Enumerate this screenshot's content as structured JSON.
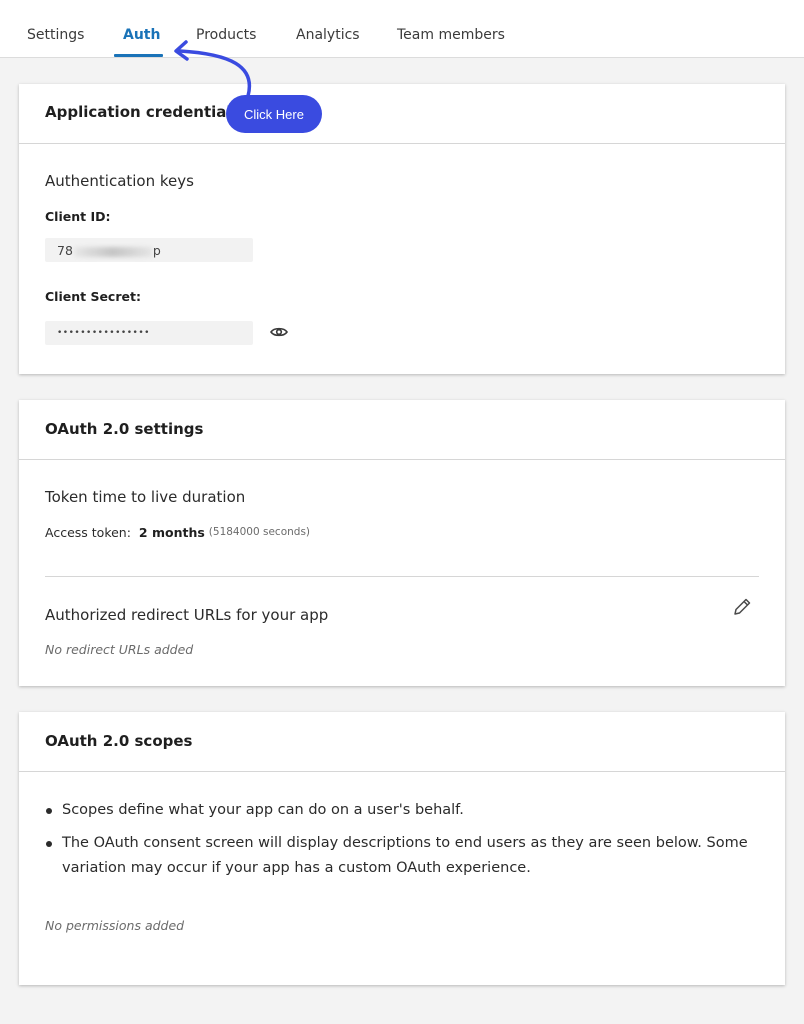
{
  "tabs": [
    {
      "label": "Settings",
      "active": false
    },
    {
      "label": "Auth",
      "active": true
    },
    {
      "label": "Products",
      "active": false
    },
    {
      "label": "Analytics",
      "active": false
    },
    {
      "label": "Team members",
      "active": false
    }
  ],
  "callout": {
    "label": "Click Here",
    "color": "#3a4be0"
  },
  "credentials": {
    "title": "Application credentials",
    "section_title": "Authentication keys",
    "client_id_label": "Client ID:",
    "client_id_prefix": "78",
    "client_id_suffix": "p",
    "client_secret_label": "Client Secret:",
    "client_secret_value": "••••••••••••••••",
    "reveal_icon": "eye-icon"
  },
  "oauth_settings": {
    "title": "OAuth 2.0 settings",
    "ttl_title": "Token time to live duration",
    "access_token_label": "Access token:",
    "access_token_value": "2 months",
    "access_token_seconds": "(5184000 seconds)",
    "redirect_title": "Authorized redirect URLs for your app",
    "redirect_empty": "No redirect URLs added",
    "edit_icon": "pencil-icon"
  },
  "oauth_scopes": {
    "title": "OAuth 2.0 scopes",
    "bullets": [
      "Scopes define what your app can do on a user's behalf.",
      "The OAuth consent screen will display descriptions to end users as they are seen below. Some variation may occur if your app has a custom OAuth experience."
    ],
    "empty": "No permissions added"
  },
  "colors": {
    "accent": "#1a73b8",
    "page_background": "#f3f3f3"
  }
}
